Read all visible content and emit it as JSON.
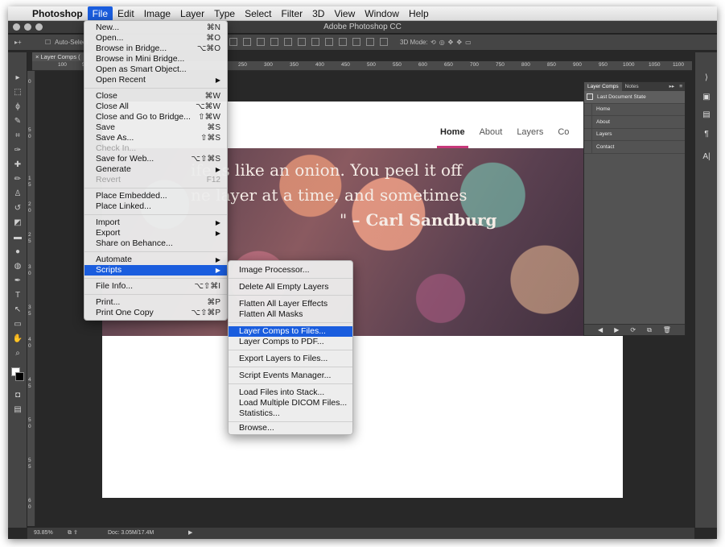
{
  "menubar": {
    "apple": "",
    "items": [
      "Photoshop",
      "File",
      "Edit",
      "Image",
      "Layer",
      "Type",
      "Select",
      "Filter",
      "3D",
      "View",
      "Window",
      "Help"
    ]
  },
  "window": {
    "title": "Adobe Photoshop CC"
  },
  "options_bar": {
    "auto_select": "Auto-Select",
    "mode_3d": "3D Mode:"
  },
  "doc_tab": {
    "label": "Layer Comps ("
  },
  "ruler": {
    "h_ticks": [
      "100",
      "50",
      "250",
      "300",
      "350",
      "400",
      "450",
      "500",
      "550",
      "600",
      "650",
      "700",
      "750",
      "800",
      "850",
      "900",
      "950",
      "1000",
      "1050",
      "1100"
    ],
    "v_ticks": [
      "0",
      "5",
      "0",
      "1",
      "5",
      "2",
      "0",
      "2",
      "5",
      "3",
      "0",
      "3",
      "5",
      "4",
      "0",
      "4",
      "5",
      "5",
      "0",
      "5",
      "5",
      "6",
      "0"
    ]
  },
  "website": {
    "nav": [
      "Home",
      "About",
      "Layers",
      "Co"
    ],
    "quote_line1": "ife is like an onion. You peel it off",
    "quote_line2": "ne layer at a time, and sometimes",
    "quote_line3_prefix": "\"",
    "quote_author": "– Carl Sandburg"
  },
  "layer_comps_panel": {
    "tabs": [
      "Layer Comps",
      "Notes"
    ],
    "collapse": "▸▸",
    "menu": "≡",
    "rows": [
      "Last Document State",
      "Home",
      "About",
      "Layers",
      "Contact"
    ],
    "footer": [
      "◀",
      "▶",
      "⟳",
      "⧉",
      "🗑"
    ]
  },
  "status_bar": {
    "zoom": "93.85%",
    "doc": "Doc: 3.05M/17.4M",
    "arrow": "▶"
  },
  "file_menu": {
    "items": [
      {
        "label": "New...",
        "shortcut": "⌘N"
      },
      {
        "label": "Open...",
        "shortcut": "⌘O"
      },
      {
        "label": "Browse in Bridge...",
        "shortcut": "⌥⌘O"
      },
      {
        "label": "Browse in Mini Bridge...",
        "shortcut": ""
      },
      {
        "label": "Open as Smart Object...",
        "shortcut": ""
      },
      {
        "label": "Open Recent",
        "shortcut": "▶"
      },
      {
        "label": "Close",
        "shortcut": "⌘W"
      },
      {
        "label": "Close All",
        "shortcut": "⌥⌘W"
      },
      {
        "label": "Close and Go to Bridge...",
        "shortcut": "⇧⌘W"
      },
      {
        "label": "Save",
        "shortcut": "⌘S"
      },
      {
        "label": "Save As...",
        "shortcut": "⇧⌘S"
      },
      {
        "label": "Check In...",
        "shortcut": ""
      },
      {
        "label": "Save for Web...",
        "shortcut": "⌥⇧⌘S"
      },
      {
        "label": "Generate",
        "shortcut": "▶"
      },
      {
        "label": "Revert",
        "shortcut": "F12"
      },
      {
        "label": "Place Embedded...",
        "shortcut": ""
      },
      {
        "label": "Place Linked...",
        "shortcut": ""
      },
      {
        "label": "Import",
        "shortcut": "▶"
      },
      {
        "label": "Export",
        "shortcut": "▶"
      },
      {
        "label": "Share on Behance...",
        "shortcut": ""
      },
      {
        "label": "Automate",
        "shortcut": "▶"
      },
      {
        "label": "Scripts",
        "shortcut": "▶"
      },
      {
        "label": "File Info...",
        "shortcut": "⌥⇧⌘I"
      },
      {
        "label": "Print...",
        "shortcut": "⌘P"
      },
      {
        "label": "Print One Copy",
        "shortcut": "⌥⇧⌘P"
      }
    ]
  },
  "scripts_menu": {
    "items": [
      "Image Processor...",
      "Delete All Empty Layers",
      "Flatten All Layer Effects",
      "Flatten All Masks",
      "Layer Comps to Files...",
      "Layer Comps to PDF...",
      "Export Layers to Files...",
      "Script Events Manager...",
      "Load Files into Stack...",
      "Load Multiple DICOM Files...",
      "Statistics...",
      "Browse..."
    ]
  },
  "colors": {
    "accent": "#1a5dde",
    "nav_underline": "#c7397a"
  }
}
